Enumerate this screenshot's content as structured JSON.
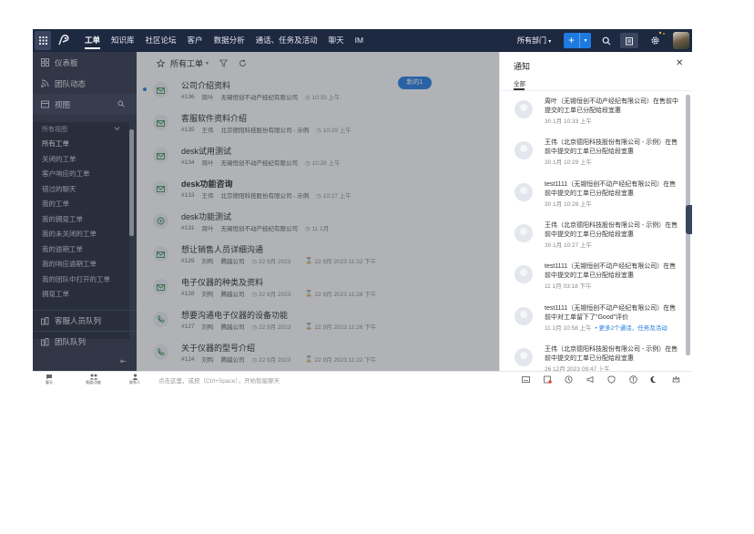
{
  "topnav": {
    "items": [
      "工单",
      "知识库",
      "社区论坛",
      "客户",
      "数据分析",
      "通话、任务及活动",
      "聊天",
      "IM"
    ],
    "active": "工单",
    "department": "所有部门",
    "plus_label": "+"
  },
  "sidebar": {
    "top_items": [
      "仪表板",
      "团队动态"
    ],
    "views_label": "视图",
    "all_views": "所有视图",
    "view_items": [
      "所有工单",
      "关闭的工单",
      "客户响应的工单",
      "错过的聊天",
      "我的工单",
      "我的拥趸工单",
      "我的未关闭的工单",
      "我的逾期工单",
      "我的响应逾期工单",
      "我的团队中打开的工单",
      "拥趸工单"
    ],
    "bottom_items": [
      "客服人员队列",
      "团队队列"
    ]
  },
  "main": {
    "view_title": "所有工单",
    "new_badge": "新的1",
    "tickets": [
      {
        "title": "公司介绍资料",
        "id": "#136",
        "owner": "周叶",
        "org": "无锡恒创不动产经纪有限公司",
        "time": "10:33 上午",
        "bold": false,
        "unread": true,
        "icon": "mail-icon"
      },
      {
        "title": "客服软件资料介绍",
        "id": "#135",
        "owner": "王伟",
        "org": "北京德阳科技股份有限公司 - 示例",
        "time": "10:29 上午",
        "bold": false,
        "unread": false,
        "icon": "mail-icon"
      },
      {
        "title": "desk试用测试",
        "id": "#134",
        "owner": "周叶",
        "org": "无锡恒创不动产经纪有限公司",
        "time": "10:28 上午",
        "bold": false,
        "unread": false,
        "icon": "mail-icon"
      },
      {
        "title": "desk功能咨询",
        "id": "#133",
        "owner": "王伟",
        "org": "北京德阳科技股份有限公司 - 示例",
        "time": "10:27 上午",
        "bold": true,
        "unread": false,
        "icon": "mail-icon"
      },
      {
        "title": "desk功能测试",
        "id": "#131",
        "owner": "周叶",
        "org": "无锡恒创不动产经纪有限公司",
        "time": "11 1月",
        "bold": false,
        "unread": false,
        "icon": "chat-icon"
      },
      {
        "title": "想让销售人员详细沟通",
        "id": "#129",
        "owner": "刘鸭",
        "org": "腾越公司",
        "created": "22 9月 2023",
        "due": "22 9月 2023 11:32 下午",
        "bold": false,
        "unread": false,
        "icon": "mail-icon"
      },
      {
        "title": "电子仪器的种类及资料",
        "id": "#128",
        "owner": "刘鸭",
        "org": "腾越公司",
        "created": "22 9月 2023",
        "due": "22 9月 2023 11:28 下午",
        "bold": false,
        "unread": false,
        "icon": "mail-icon"
      },
      {
        "title": "想要沟通电子仪器的设备功能",
        "id": "#127",
        "owner": "刘鸭",
        "org": "腾越公司",
        "created": "22 9月 2023",
        "due": "22 9月 2023 11:26 下午",
        "bold": false,
        "unread": false,
        "icon": "phone-icon"
      },
      {
        "title": "关于仪器的型号介绍",
        "id": "#124",
        "owner": "刘鸭",
        "org": "腾越公司",
        "created": "22 9月 2023",
        "due": "22 9月 2023 11:22 下午",
        "bold": false,
        "unread": false,
        "icon": "phone-icon"
      }
    ]
  },
  "notifications": {
    "title": "通知",
    "tab": "全部",
    "items": [
      {
        "text": "周叶（无锡恒创不动产经纪有限公司）在售前中提交的工单已分配给段宜惠",
        "time": "30 1月 10:33 上午"
      },
      {
        "text": "王伟（北京德阳科技股份有限公司 - 示例）在售前中提交的工单已分配给段宜惠",
        "time": "30 1月 10:29 上午"
      },
      {
        "text": "test1111（无锡恒创不动产经纪有限公司）在售前中提交的工单已分配给段宜惠",
        "time": "30 1月 10:28 上午"
      },
      {
        "text": "王伟（北京德阳科技股份有限公司 - 示例）在售前中提交的工单已分配给段宜惠",
        "time": "30 1月 10:27 上午"
      },
      {
        "text": "test1111（无锡恒创不动产经纪有限公司）在售前中提交的工单已分配给段宜惠",
        "time": "11 1月 03:18 下午"
      },
      {
        "text": "test1111（无锡恒创不动产经纪有限公司）在售前中对工单留下了\"Good\"评价",
        "time": "11 1月 10:58 上午",
        "more": "• 更多2个通话、任务及活动"
      },
      {
        "text": "王伟（北京德阳科技股份有限公司 - 示例）在售前中提交的工单已分配给段宜惠",
        "time": "26 12月 2023 09:47 上午"
      }
    ]
  },
  "statusbar": {
    "tools": [
      "聊天",
      "频道/功能",
      "联系人"
    ],
    "placeholder": "点击这里，或按（Ctrl+Space），开始智能聊天"
  }
}
